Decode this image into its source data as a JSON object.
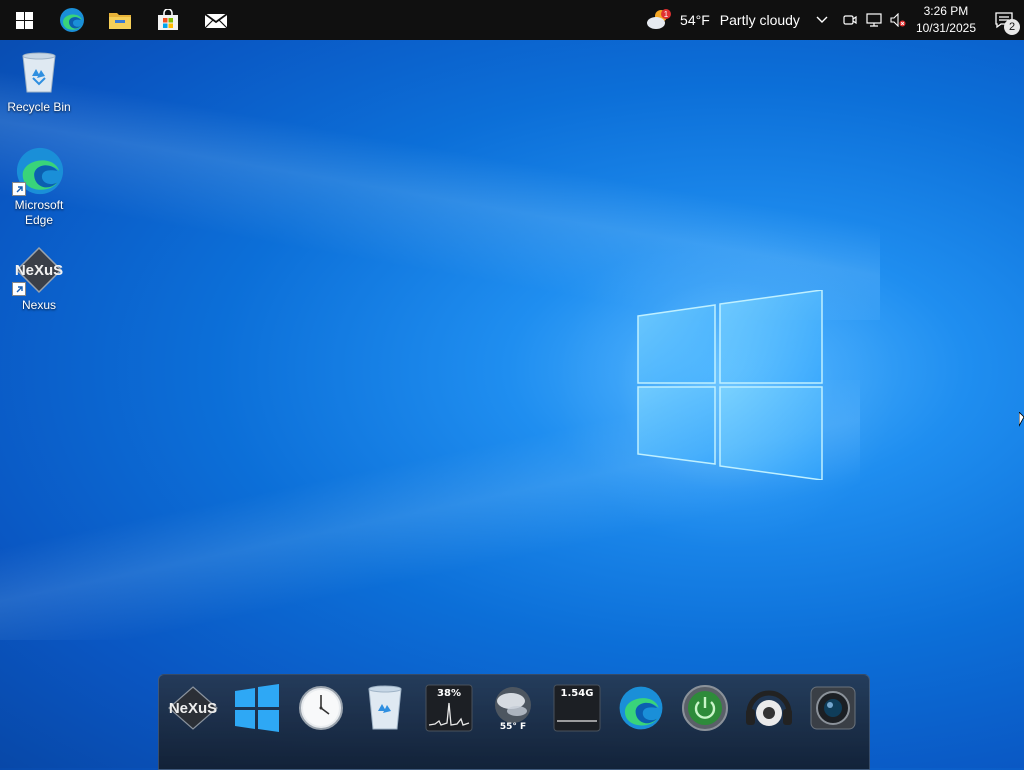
{
  "taskbar": {
    "pinned": [
      {
        "name": "start-button",
        "icon": "windows-logo-icon"
      },
      {
        "name": "edge-taskbar-button",
        "icon": "edge-icon"
      },
      {
        "name": "file-explorer-button",
        "icon": "folder-icon"
      },
      {
        "name": "store-button",
        "icon": "store-bag-icon"
      },
      {
        "name": "mail-button",
        "icon": "mail-icon"
      }
    ],
    "weather": {
      "temp": "54°F",
      "condition": "Partly cloudy",
      "badge": "1"
    },
    "clock": {
      "time": "3:26 PM",
      "date": "10/31/2025"
    },
    "notifications": {
      "count": "2"
    }
  },
  "desktop": {
    "icons": [
      {
        "label": "Recycle Bin",
        "icon": "recycle-bin-icon"
      },
      {
        "label": "Microsoft Edge",
        "icon": "edge-icon"
      },
      {
        "label": "Nexus",
        "icon": "nexus-icon"
      }
    ]
  },
  "dock": {
    "items": [
      {
        "name": "nexus-logo"
      },
      {
        "name": "windows-start"
      },
      {
        "name": "clock"
      },
      {
        "name": "recycle-bin"
      },
      {
        "name": "cpu-meter",
        "value": "38%"
      },
      {
        "name": "weather-globe",
        "value": "55° F"
      },
      {
        "name": "memory-meter",
        "value": "1.54G"
      },
      {
        "name": "edge-browser"
      },
      {
        "name": "power"
      },
      {
        "name": "music-player"
      },
      {
        "name": "camera"
      }
    ]
  },
  "colors": {
    "taskbar": "#101010",
    "accent": "#0c6fd8"
  }
}
